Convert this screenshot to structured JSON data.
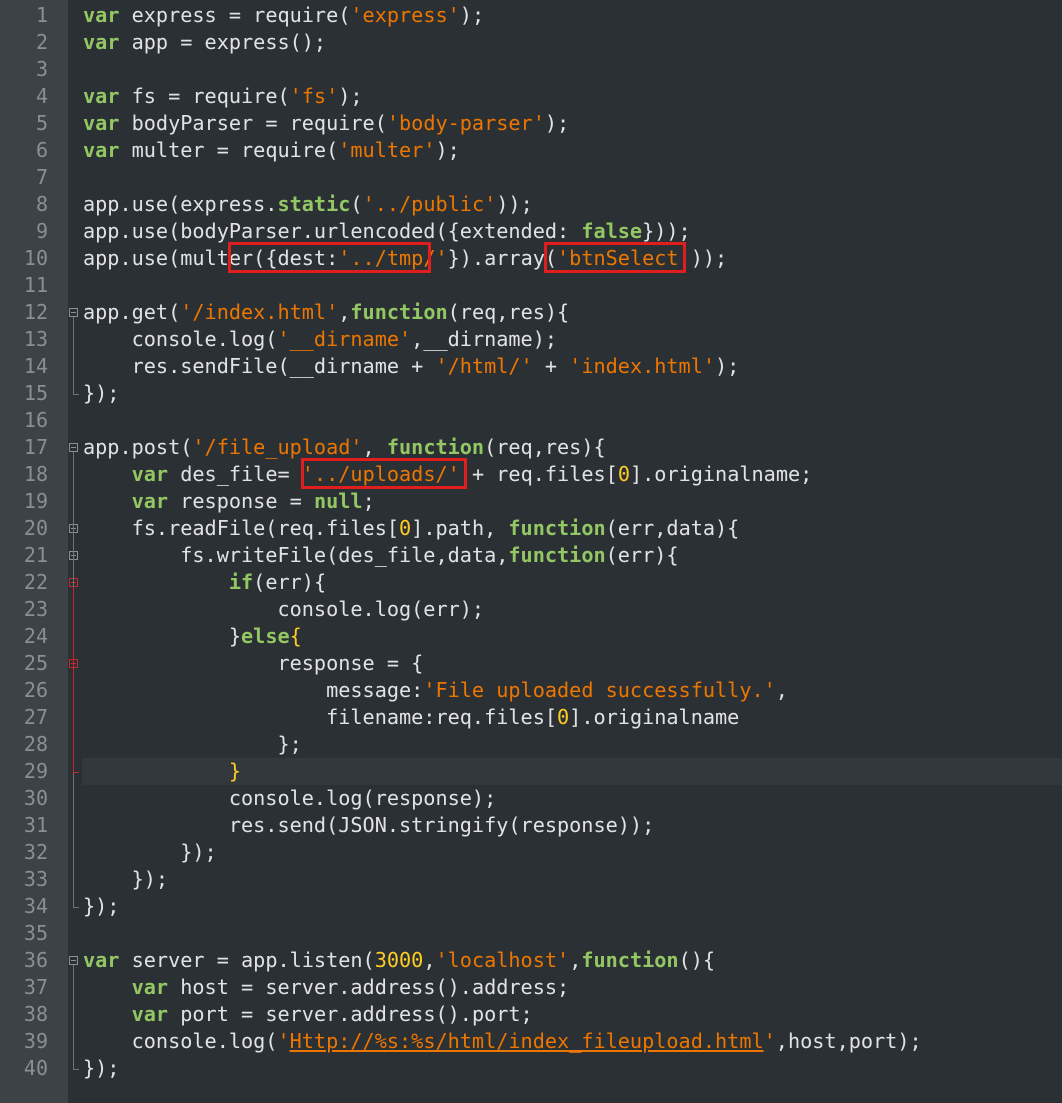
{
  "editor": {
    "colors": {
      "background": "#2b3034",
      "gutter": "#3c4246",
      "keyword": "#93c763",
      "string": "#ec7600",
      "number": "#ffcd22",
      "text": "#e0e2e4",
      "highlight_box": "#e01e1e"
    },
    "line_numbers": [
      "1",
      "2",
      "3",
      "4",
      "5",
      "6",
      "7",
      "8",
      "9",
      "10",
      "11",
      "12",
      "13",
      "14",
      "15",
      "16",
      "17",
      "18",
      "19",
      "20",
      "21",
      "22",
      "23",
      "24",
      "25",
      "26",
      "27",
      "28",
      "29",
      "30",
      "31",
      "32",
      "33",
      "34",
      "35",
      "36",
      "37",
      "38",
      "39",
      "40"
    ],
    "current_line": 29,
    "fold_markers": [
      12,
      17,
      20,
      21,
      22,
      25,
      36
    ],
    "highlight_boxes": [
      "{dest:'../tmp/'}",
      "'btnSelect'",
      "'../uploads/'"
    ],
    "lines": [
      [
        [
          "k",
          "var"
        ],
        [
          "t",
          " express = require("
        ],
        [
          "s",
          "'express'"
        ],
        [
          "t",
          ");"
        ]
      ],
      [
        [
          "k",
          "var"
        ],
        [
          "t",
          " app = express();"
        ]
      ],
      [],
      [
        [
          "k",
          "var"
        ],
        [
          "t",
          " fs = require("
        ],
        [
          "s",
          "'fs'"
        ],
        [
          "t",
          ");"
        ]
      ],
      [
        [
          "k",
          "var"
        ],
        [
          "t",
          " bodyParser = require("
        ],
        [
          "s",
          "'body-parser'"
        ],
        [
          "t",
          ");"
        ]
      ],
      [
        [
          "k",
          "var"
        ],
        [
          "t",
          " multer = require("
        ],
        [
          "s",
          "'multer'"
        ],
        [
          "t",
          ");"
        ]
      ],
      [],
      [
        [
          "t",
          "app.use(express."
        ],
        [
          "k",
          "static"
        ],
        [
          "t",
          "("
        ],
        [
          "s",
          "'../public'"
        ],
        [
          "t",
          "));"
        ]
      ],
      [
        [
          "t",
          "app.use(bodyParser.urlencoded({extended: "
        ],
        [
          "k",
          "false"
        ],
        [
          "t",
          "}));"
        ]
      ],
      [
        [
          "t",
          "app.use(multer("
        ],
        [
          "t",
          "{dest:"
        ],
        [
          "s",
          "'../tmp/'"
        ],
        [
          "t",
          "}"
        ],
        [
          "t",
          ").array("
        ],
        [
          "s",
          "'btnSelect'"
        ],
        [
          "t",
          "));"
        ]
      ],
      [],
      [
        [
          "t",
          "app.get("
        ],
        [
          "s",
          "'/index.html'"
        ],
        [
          "t",
          ","
        ],
        [
          "k",
          "function"
        ],
        [
          "t",
          "(req,res){"
        ]
      ],
      [
        [
          "t",
          "    console.log("
        ],
        [
          "s",
          "'__dirname'"
        ],
        [
          "t",
          ",__dirname);"
        ]
      ],
      [
        [
          "t",
          "    res.sendFile(__dirname + "
        ],
        [
          "s",
          "'/html/'"
        ],
        [
          "t",
          " + "
        ],
        [
          "s",
          "'index.html'"
        ],
        [
          "t",
          ");"
        ]
      ],
      [
        [
          "t",
          "});"
        ]
      ],
      [],
      [
        [
          "t",
          "app.post("
        ],
        [
          "s",
          "'/file_upload'"
        ],
        [
          "t",
          ", "
        ],
        [
          "k",
          "function"
        ],
        [
          "t",
          "(req,res){"
        ]
      ],
      [
        [
          "t",
          "    "
        ],
        [
          "k",
          "var"
        ],
        [
          "t",
          " des_file= "
        ],
        [
          "s",
          "'../uploads/'"
        ],
        [
          "t",
          " + req.files["
        ],
        [
          "n",
          "0"
        ],
        [
          "t",
          "].originalname;"
        ]
      ],
      [
        [
          "t",
          "    "
        ],
        [
          "k",
          "var"
        ],
        [
          "t",
          " response = "
        ],
        [
          "k",
          "null"
        ],
        [
          "t",
          ";"
        ]
      ],
      [
        [
          "t",
          "    fs.readFile(req.files["
        ],
        [
          "n",
          "0"
        ],
        [
          "t",
          "].path, "
        ],
        [
          "k",
          "function"
        ],
        [
          "t",
          "(err,data){"
        ]
      ],
      [
        [
          "t",
          "        fs.writeFile(des_file,data,"
        ],
        [
          "k",
          "function"
        ],
        [
          "t",
          "(err){"
        ]
      ],
      [
        [
          "t",
          "            "
        ],
        [
          "k",
          "if"
        ],
        [
          "t",
          "(err){"
        ]
      ],
      [
        [
          "t",
          "                console.log(err);"
        ]
      ],
      [
        [
          "t",
          "            }"
        ],
        [
          "k",
          "else"
        ],
        [
          "n",
          "{"
        ]
      ],
      [
        [
          "t",
          "                response = {"
        ]
      ],
      [
        [
          "t",
          "                    message:"
        ],
        [
          "s",
          "'File uploaded successfully.'"
        ],
        [
          "t",
          ","
        ]
      ],
      [
        [
          "t",
          "                    filename:req.files["
        ],
        [
          "n",
          "0"
        ],
        [
          "t",
          "].originalname"
        ]
      ],
      [
        [
          "t",
          "                };"
        ]
      ],
      [
        [
          "t",
          "            "
        ],
        [
          "n",
          "}"
        ]
      ],
      [
        [
          "t",
          "            console.log(response);"
        ]
      ],
      [
        [
          "t",
          "            res.send(JSON.stringify(response));"
        ]
      ],
      [
        [
          "t",
          "        });"
        ]
      ],
      [
        [
          "t",
          "    });"
        ]
      ],
      [
        [
          "t",
          "});"
        ]
      ],
      [],
      [
        [
          "k",
          "var"
        ],
        [
          "t",
          " server = app.listen("
        ],
        [
          "n",
          "3000"
        ],
        [
          "t",
          ","
        ],
        [
          "s",
          "'localhost'"
        ],
        [
          "t",
          ","
        ],
        [
          "k",
          "function"
        ],
        [
          "t",
          "(){"
        ]
      ],
      [
        [
          "t",
          "    "
        ],
        [
          "k",
          "var"
        ],
        [
          "t",
          " host = server.address().address;"
        ]
      ],
      [
        [
          "t",
          "    "
        ],
        [
          "k",
          "var"
        ],
        [
          "t",
          " port = server.address().port;"
        ]
      ],
      [
        [
          "t",
          "    console.log("
        ],
        [
          "s",
          "'"
        ],
        [
          "u",
          "Http://%s:%s/html/index_fileupload.html"
        ],
        [
          "s",
          "'"
        ],
        [
          "t",
          ",host,port);"
        ]
      ],
      [
        [
          "t",
          "});"
        ]
      ]
    ]
  }
}
